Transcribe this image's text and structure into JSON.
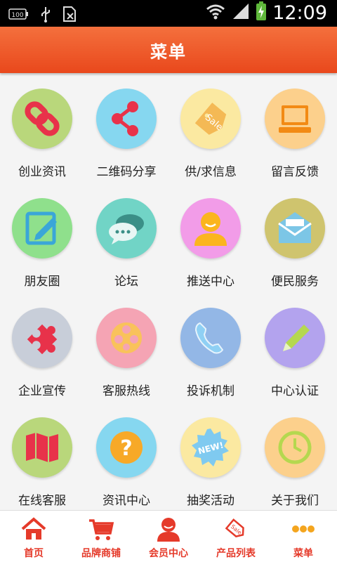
{
  "status_bar": {
    "time": "12:09",
    "battery_label": "100",
    "icons": [
      "battery-level-icon",
      "usb-icon",
      "sim-icon",
      "wifi-icon",
      "signal-icon",
      "battery-charging-icon"
    ]
  },
  "header": {
    "title": "菜单"
  },
  "menu": {
    "items": [
      {
        "label": "创业资讯",
        "icon": "link-icon",
        "color": "#b9d77b"
      },
      {
        "label": "二维码分享",
        "icon": "share-icon",
        "color": "#86d7f0"
      },
      {
        "label": "供/求信息",
        "icon": "sale-tag-icon",
        "color": "#fbe9a1"
      },
      {
        "label": "留言反馈",
        "icon": "computer-icon",
        "color": "#fcd08c"
      },
      {
        "label": "朋友圈",
        "icon": "edit-note-icon",
        "color": "#8fe08c"
      },
      {
        "label": "论坛",
        "icon": "chat-bubbles-icon",
        "color": "#71d4c6"
      },
      {
        "label": "推送中心",
        "icon": "user-icon",
        "color": "#f29ce8"
      },
      {
        "label": "便民服务",
        "icon": "mail-icon",
        "color": "#cfc46e"
      },
      {
        "label": "企业宣传",
        "icon": "puzzle-icon",
        "color": "#c8ced9"
      },
      {
        "label": "客服热线",
        "icon": "film-reel-icon",
        "color": "#f5a4b4"
      },
      {
        "label": "投诉机制",
        "icon": "phone-icon",
        "color": "#93b7e6"
      },
      {
        "label": "中心认证",
        "icon": "pencil-icon",
        "color": "#b3a3ee"
      },
      {
        "label": "在线客服",
        "icon": "map-icon",
        "color": "#b9d77b"
      },
      {
        "label": "资讯中心",
        "icon": "help-icon",
        "color": "#86d7f0"
      },
      {
        "label": "抽奖活动",
        "icon": "new-badge-icon",
        "color": "#fbe9a1"
      },
      {
        "label": "关于我们",
        "icon": "clock-icon",
        "color": "#fcd08c"
      }
    ]
  },
  "tab_bar": {
    "tabs": [
      {
        "label": "首页",
        "icon": "home-icon"
      },
      {
        "label": "品牌商铺",
        "icon": "cart-icon"
      },
      {
        "label": "会员中心",
        "icon": "member-icon"
      },
      {
        "label": "产品列表",
        "icon": "sale-tag-icon"
      },
      {
        "label": "菜单",
        "icon": "more-icon"
      }
    ],
    "accent": "#e53a2a"
  }
}
